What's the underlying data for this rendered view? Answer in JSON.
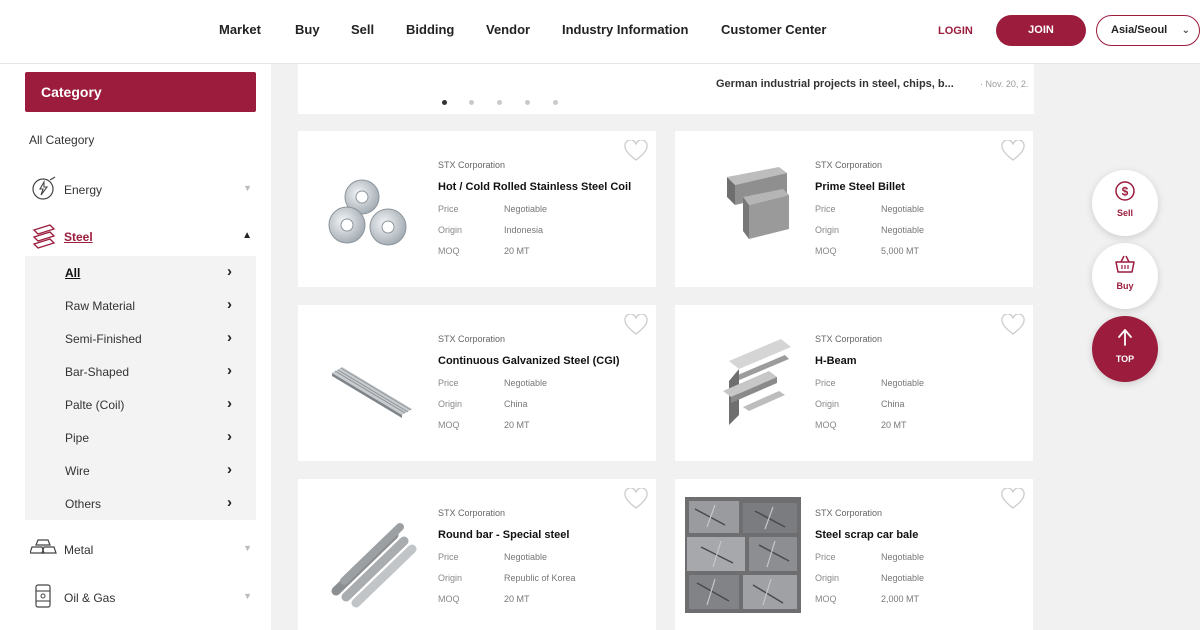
{
  "nav": [
    "Market",
    "Buy",
    "Sell",
    "Bidding",
    "Vendor",
    "Industry Information",
    "Customer Center"
  ],
  "header": {
    "login": "LOGIN",
    "join": "JOIN",
    "timezone": "Asia/Seoul"
  },
  "sidebar": {
    "heading": "Category",
    "all_category": "All Category",
    "categories": [
      {
        "label": "Energy",
        "icon": "energy-icon"
      },
      {
        "label": "Steel",
        "icon": "steel-icon"
      },
      {
        "label": "Metal",
        "icon": "metal-icon"
      },
      {
        "label": "Oil & Gas",
        "icon": "oil-barrel-icon"
      }
    ],
    "subcategories": [
      "All",
      "Raw Material",
      "Semi-Finished",
      "Bar-Shaped",
      "Palte (Coil)",
      "Pipe",
      "Wire",
      "Others"
    ]
  },
  "banner": {
    "news": "German industrial projects in steel, chips, b...",
    "date": "· Nov. 20, 2."
  },
  "labels": {
    "price": "Price",
    "origin": "Origin",
    "moq": "MOQ"
  },
  "products": [
    {
      "vendor": "STX Corporation",
      "title": "Hot / Cold Rolled Stainless Steel Coil",
      "price": "Negotiable",
      "origin": "Indonesia",
      "moq": "20 MT",
      "image": "steel-coil"
    },
    {
      "vendor": "STX Corporation",
      "title": "Prime Steel Billet",
      "price": "Negotiable",
      "origin": "Negotiable",
      "moq": "5,000 MT",
      "image": "steel-billet"
    },
    {
      "vendor": "STX Corporation",
      "title": "Continuous Galvanized Steel (CGI)",
      "price": "Negotiable",
      "origin": "China",
      "moq": "20 MT",
      "image": "galvanized-sheet"
    },
    {
      "vendor": "STX Corporation",
      "title": "H-Beam",
      "price": "Negotiable",
      "origin": "China",
      "moq": "20 MT",
      "image": "h-beam"
    },
    {
      "vendor": "STX Corporation",
      "title": "Round bar - Special steel",
      "price": "Negotiable",
      "origin": "Republic of Korea",
      "moq": "20 MT",
      "image": "round-bar"
    },
    {
      "vendor": "STX Corporation",
      "title": "Steel scrap car bale",
      "price": "Negotiable",
      "origin": "Negotiable",
      "moq": "2,000 MT",
      "image": "scrap-bale"
    }
  ],
  "floating": {
    "sell": "Sell",
    "buy": "Buy",
    "top": "TOP"
  },
  "colors": {
    "brand": "#9b1c3c",
    "background": "#f1f1f1"
  }
}
